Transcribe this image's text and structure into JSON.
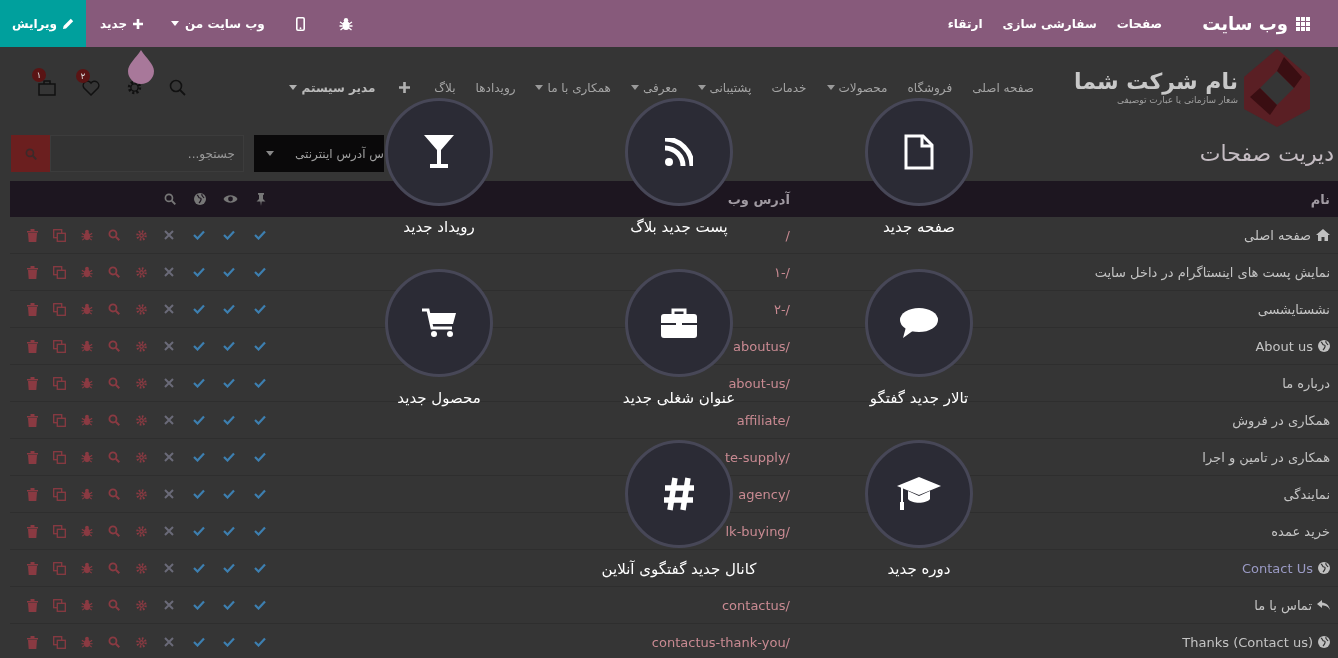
{
  "top_bar": {
    "brand": "وب سایت",
    "menu": [
      "صفحات",
      "سفارشی سازی",
      "ارتقاء"
    ],
    "site_menu": "وب سایت من",
    "new_button": "جدید",
    "edit_button": "ویرایش"
  },
  "site_header": {
    "company": "نام شرکت شما",
    "tagline": "شعار سازمانی یا عبارت توصیفی",
    "nav": [
      {
        "label": "صفحه اصلی",
        "dropdown": false
      },
      {
        "label": "فروشگاه",
        "dropdown": false
      },
      {
        "label": "محصولات",
        "dropdown": true
      },
      {
        "label": "خدمات",
        "dropdown": false
      },
      {
        "label": "پشتیبانی",
        "dropdown": true
      },
      {
        "label": "معرفی",
        "dropdown": true
      },
      {
        "label": "همکاری با ما",
        "dropdown": true
      },
      {
        "label": "رویدادها",
        "dropdown": false
      },
      {
        "label": "بلاگ",
        "dropdown": false
      }
    ],
    "user": "مدیر سیستم",
    "wishlist_count": "۲",
    "cart_count": "۱"
  },
  "page_title": "دیریت صفحات",
  "sort_select": "س آدرس اینترنتی",
  "search": {
    "placeholder": "جستجو..."
  },
  "table": {
    "columns": [
      "نام",
      "آدرس وب"
    ],
    "rows": [
      {
        "kind": "home",
        "name": "صفحه اصلی",
        "url": "/",
        "menu": true,
        "visible": true,
        "published": true,
        "indexed": false
      },
      {
        "kind": "page",
        "name": "نمایش پست های اینستاگرام در داخل سایت",
        "url": "۱-/",
        "menu": true,
        "visible": true,
        "published": true,
        "indexed": false
      },
      {
        "kind": "page",
        "name": "نشستایشسی",
        "url": "۲-/",
        "menu": true,
        "visible": true,
        "published": true,
        "indexed": false
      },
      {
        "kind": "website",
        "name": "About us",
        "url": "aboutus/",
        "menu": true,
        "visible": true,
        "published": true,
        "indexed": false
      },
      {
        "kind": "page",
        "name": "درباره ما",
        "url": "about-us/",
        "menu": true,
        "visible": true,
        "published": true,
        "indexed": false
      },
      {
        "kind": "page",
        "name": "همکاری در فروش",
        "url": "affiliate/",
        "menu": true,
        "visible": true,
        "published": true,
        "indexed": false
      },
      {
        "kind": "page",
        "name": "همکاری در تامین و اجرا",
        "url": "te-supply/",
        "menu": true,
        "visible": true,
        "published": true,
        "indexed": false
      },
      {
        "kind": "page",
        "name": "نمایندگی",
        "url": "agency/",
        "menu": true,
        "visible": true,
        "published": true,
        "indexed": false
      },
      {
        "kind": "page",
        "name": "خرید عمده",
        "url": "lk-buying/",
        "menu": true,
        "visible": true,
        "published": true,
        "indexed": false
      },
      {
        "kind": "website",
        "name": "Contact Us",
        "menu": true,
        "visible": true,
        "published": true,
        "indexed": false
      },
      {
        "kind": "redirect",
        "name": "تماس با ما",
        "url": "contactus/",
        "menu": true,
        "visible": true,
        "published": true,
        "indexed": false
      },
      {
        "kind": "website",
        "name": "Thanks (Contact us)",
        "url": "contactus-thank-you/",
        "menu": true,
        "visible": true,
        "published": true,
        "indexed": false
      }
    ]
  },
  "new_content_menu": [
    {
      "kind": "page",
      "label": "صفحه جدید"
    },
    {
      "kind": "blog",
      "label": "پست جدید بلاگ"
    },
    {
      "kind": "event",
      "label": "رویداد جدید"
    },
    {
      "kind": "forum",
      "label": "تالار جدید گفتگو"
    },
    {
      "kind": "job",
      "label": "عنوان شغلی جدید"
    },
    {
      "kind": "product",
      "label": "محصول جدید"
    },
    {
      "kind": "course",
      "label": "دوره جدید"
    },
    {
      "kind": "channel",
      "label": "کانال جدید گفتگوی آنلاین"
    }
  ]
}
